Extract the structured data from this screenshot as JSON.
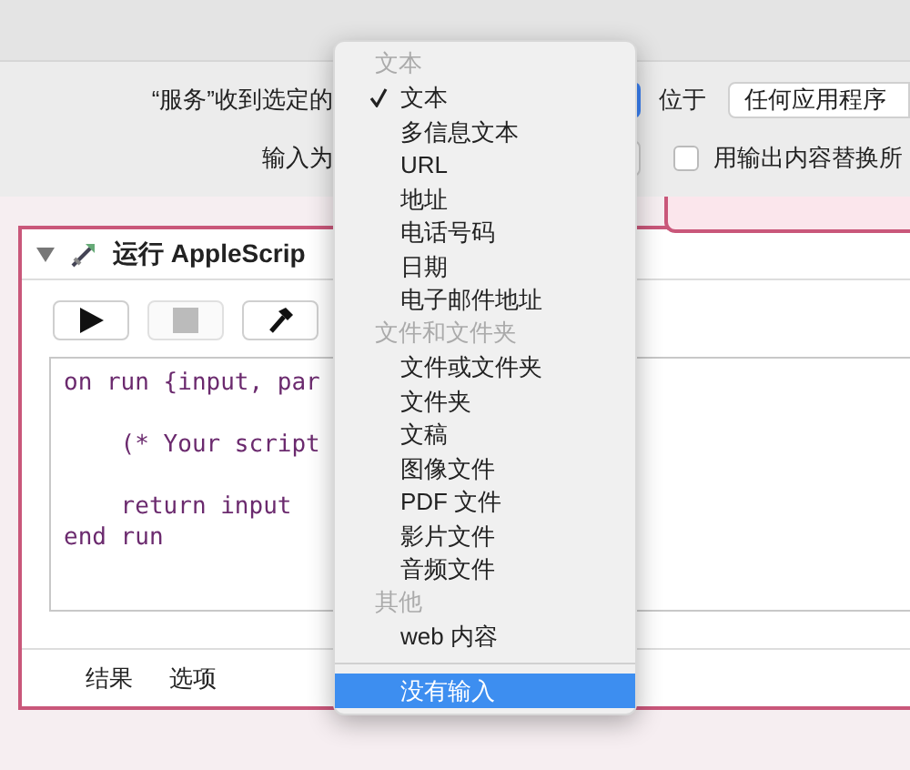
{
  "header": {
    "service_label": "“服务”收到选定的",
    "location_label": "位于",
    "location_value": "任何应用程序",
    "input_label": "输入为",
    "replace_checkbox": {
      "label": "用输出内容替换所",
      "checked": false
    }
  },
  "action": {
    "expanded": true,
    "title": "运行 AppleScrip",
    "buttons": [
      {
        "kind": "run",
        "disabled": false
      },
      {
        "kind": "stop",
        "disabled": true
      },
      {
        "kind": "compile",
        "disabled": false
      }
    ],
    "code": "on run {input, par\n\n    (* Your script\n\n    return input\nend run",
    "tabs": [
      {
        "label": "结果"
      },
      {
        "label": "选项"
      }
    ]
  },
  "menu": [
    {
      "kind": "header",
      "label": "文本"
    },
    {
      "kind": "item",
      "label": "文本",
      "checked": true,
      "highlighted": false
    },
    {
      "kind": "item",
      "label": "多信息文本",
      "checked": false,
      "highlighted": false
    },
    {
      "kind": "item",
      "label": "URL",
      "checked": false,
      "highlighted": false
    },
    {
      "kind": "item",
      "label": "地址",
      "checked": false,
      "highlighted": false
    },
    {
      "kind": "item",
      "label": "电话号码",
      "checked": false,
      "highlighted": false
    },
    {
      "kind": "item",
      "label": "日期",
      "checked": false,
      "highlighted": false
    },
    {
      "kind": "item",
      "label": "电子邮件地址",
      "checked": false,
      "highlighted": false
    },
    {
      "kind": "header",
      "label": "文件和文件夹"
    },
    {
      "kind": "item",
      "label": "文件或文件夹",
      "checked": false,
      "highlighted": false
    },
    {
      "kind": "item",
      "label": "文件夹",
      "checked": false,
      "highlighted": false
    },
    {
      "kind": "item",
      "label": "文稿",
      "checked": false,
      "highlighted": false
    },
    {
      "kind": "item",
      "label": "图像文件",
      "checked": false,
      "highlighted": false
    },
    {
      "kind": "item",
      "label": "PDF 文件",
      "checked": false,
      "highlighted": false
    },
    {
      "kind": "item",
      "label": "影片文件",
      "checked": false,
      "highlighted": false
    },
    {
      "kind": "item",
      "label": "音频文件",
      "checked": false,
      "highlighted": false
    },
    {
      "kind": "header",
      "label": "其他"
    },
    {
      "kind": "item",
      "label": "web 内容",
      "checked": false,
      "highlighted": false
    },
    {
      "kind": "separator"
    },
    {
      "kind": "item",
      "label": "没有输入",
      "checked": false,
      "highlighted": true
    }
  ]
}
